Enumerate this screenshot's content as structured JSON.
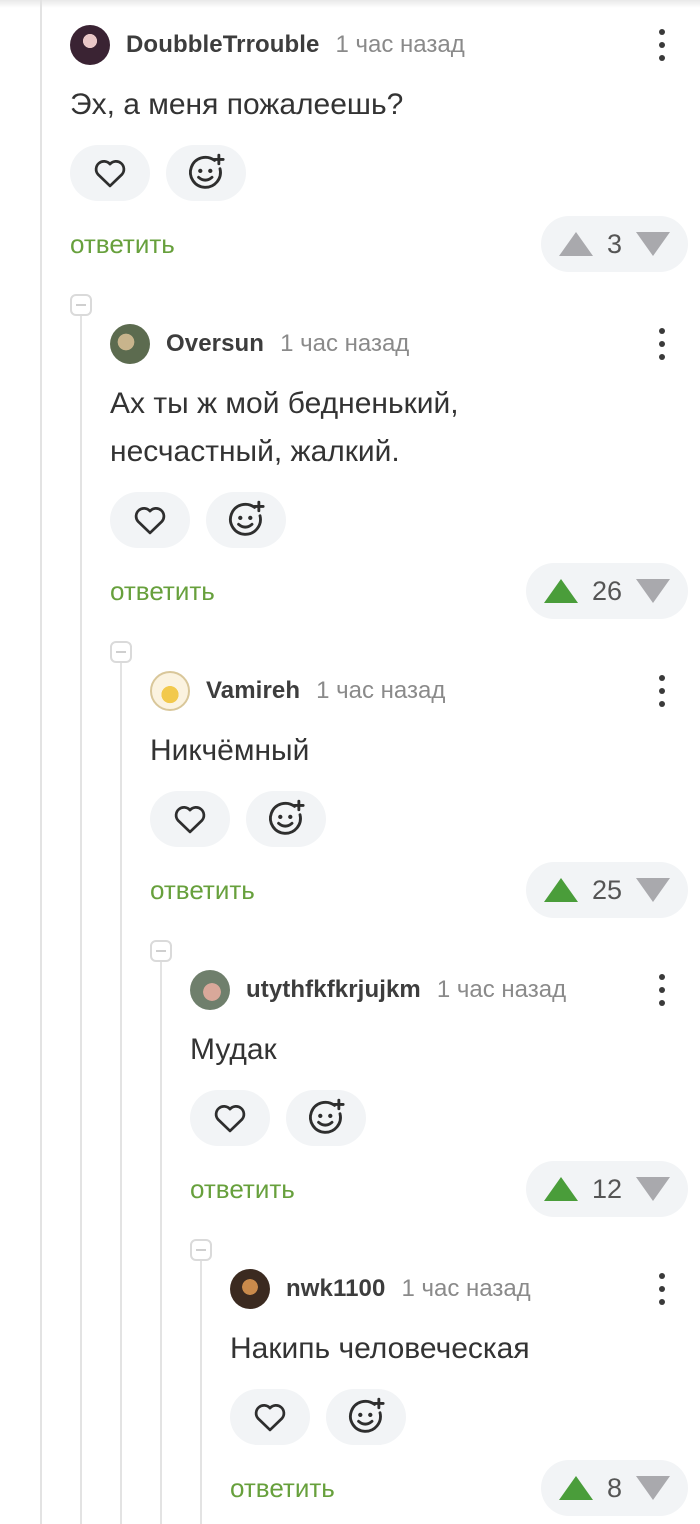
{
  "reply_label": "ответить",
  "colors": {
    "accent_green": "#67a03c",
    "vote_up_active": "#4a9d3a",
    "vote_inactive": "#a9a9ad"
  },
  "icons": {
    "like": "heart-icon",
    "react": "add-emoji-icon",
    "menu": "more-vertical-icon",
    "collapse": "minus-square-icon"
  },
  "comments": [
    {
      "username": "DoubbleTrrouble",
      "time": "1 час назад",
      "text_lines": [
        "Эх, а меня пожалеешь?"
      ],
      "score": "3",
      "upvoted": false
    },
    {
      "username": "Oversun",
      "time": "1 час назад",
      "text_lines": [
        "Ах ты ж мой бедненький,",
        "несчастный, жалкий."
      ],
      "score": "26",
      "upvoted": true
    },
    {
      "username": "Vamireh",
      "time": "1 час назад",
      "text_lines": [
        "Никчёмный"
      ],
      "score": "25",
      "upvoted": true
    },
    {
      "username": "utythfkfkrjujkm",
      "time": "1 час назад",
      "text_lines": [
        "Мудак"
      ],
      "score": "12",
      "upvoted": true
    },
    {
      "username": "nwk1100",
      "time": "1 час назад",
      "text_lines": [
        "Накипь человеческая"
      ],
      "score": "8",
      "upvoted": true
    }
  ]
}
